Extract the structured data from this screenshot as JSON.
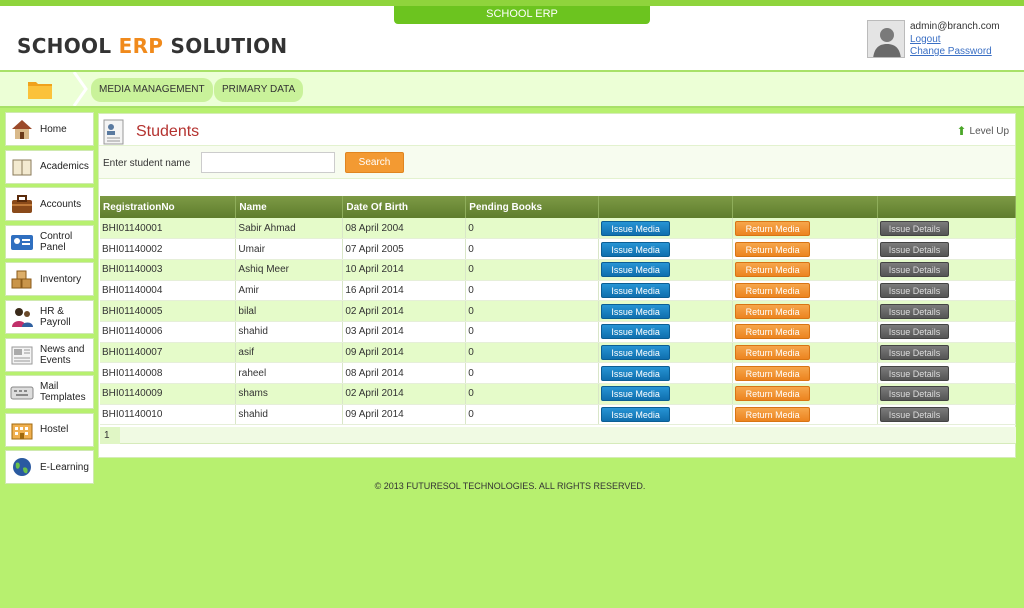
{
  "header": {
    "top_tab": "SCHOOL ERP",
    "logo_part1": "SCHOOL ",
    "logo_part2": "ERP",
    "logo_part3": " SOLUTION",
    "user_email": "admin@branch.com",
    "logout_label": "Logout",
    "change_password_label": "Change Password"
  },
  "breadcrumb": {
    "items": [
      "MEDIA MANAGEMENT",
      "PRIMARY DATA"
    ]
  },
  "sidebar": {
    "items": [
      {
        "label": "Home",
        "icon": "home-icon"
      },
      {
        "label": "Academics",
        "icon": "book-icon"
      },
      {
        "label": "Accounts",
        "icon": "briefcase-icon"
      },
      {
        "label": "Control Panel",
        "icon": "id-card-icon"
      },
      {
        "label": "Inventory",
        "icon": "boxes-icon"
      },
      {
        "label": "HR & Payroll",
        "icon": "people-icon"
      },
      {
        "label": "News and Events",
        "icon": "newspaper-icon"
      },
      {
        "label": "Mail Templates",
        "icon": "keyboard-icon"
      },
      {
        "label": "Hostel",
        "icon": "building-icon"
      },
      {
        "label": "E-Learning",
        "icon": "globe-icon"
      }
    ]
  },
  "main": {
    "title": "Students",
    "level_up_label": "Level Up",
    "search_label": "Enter student name",
    "search_value": "",
    "search_button": "Search",
    "columns": [
      "RegistrationNo",
      "Name",
      "Date Of Birth",
      "Pending Books",
      "",
      "",
      ""
    ],
    "issue_label": "Issue Media",
    "return_label": "Return Media",
    "details_label": "Issue Details",
    "rows": [
      {
        "reg": "BHI01140001",
        "name": "Sabir Ahmad",
        "dob": "08 April 2004",
        "pending": "0"
      },
      {
        "reg": "BHI01140002",
        "name": "Umair",
        "dob": "07 April 2005",
        "pending": "0"
      },
      {
        "reg": "BHI01140003",
        "name": "Ashiq Meer",
        "dob": "10 April 2014",
        "pending": "0"
      },
      {
        "reg": "BHI01140004",
        "name": "Amir",
        "dob": "16 April 2014",
        "pending": "0"
      },
      {
        "reg": "BHI01140005",
        "name": "bilal",
        "dob": "02 April 2014",
        "pending": "0"
      },
      {
        "reg": "BHI01140006",
        "name": "shahid",
        "dob": "03 April 2014",
        "pending": "0"
      },
      {
        "reg": "BHI01140007",
        "name": "asif",
        "dob": "09 April 2014",
        "pending": "0"
      },
      {
        "reg": "BHI01140008",
        "name": "raheel",
        "dob": "08 April 2014",
        "pending": "0"
      },
      {
        "reg": "BHI01140009",
        "name": "shams",
        "dob": "02 April 2014",
        "pending": "0"
      },
      {
        "reg": "BHI01140010",
        "name": "shahid",
        "dob": "09 April 2014",
        "pending": "0"
      }
    ],
    "page_number": "1"
  },
  "footer": {
    "copyright": "© 2013 FUTURESOL TECHNOLOGIES. ALL RIGHTS RESERVED."
  },
  "colors": {
    "background": "#b7f06f",
    "accent_orange": "#f39a32",
    "title_red": "#b4322f",
    "issue_blue": "#1580c2",
    "details_grey": "#666666"
  }
}
